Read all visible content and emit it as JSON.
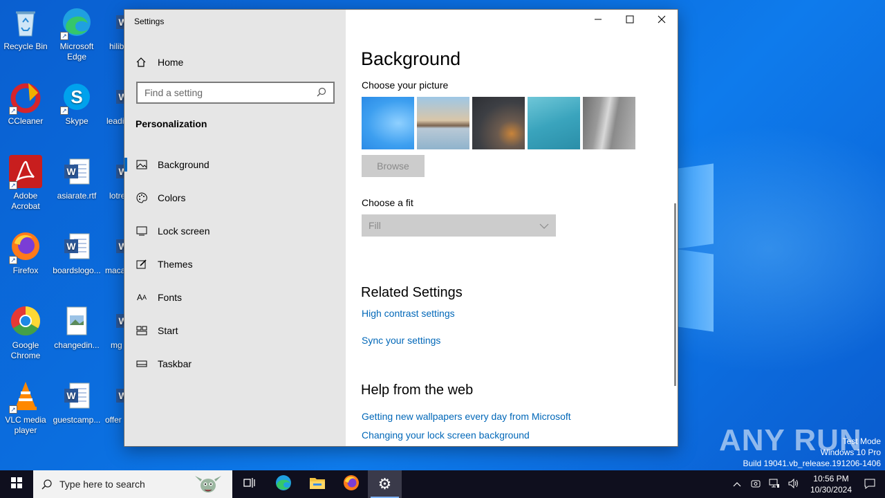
{
  "desktop": {
    "icons": [
      {
        "label": "Recycle Bin",
        "icon": "recycle-bin-icon"
      },
      {
        "label": "Microsoft Edge",
        "icon": "edge-icon"
      },
      {
        "label": "hilib",
        "icon": "word-doc-icon"
      },
      {
        "label": "CCleaner",
        "icon": "ccleaner-icon"
      },
      {
        "label": "Skype",
        "icon": "skype-icon"
      },
      {
        "label": "leadi",
        "icon": "word-doc-icon"
      },
      {
        "label": "Adobe Acrobat",
        "icon": "acrobat-icon"
      },
      {
        "label": "asiarate.rtf",
        "icon": "word-doc-icon"
      },
      {
        "label": "lotre",
        "icon": "word-doc-icon"
      },
      {
        "label": "Firefox",
        "icon": "firefox-icon"
      },
      {
        "label": "boardslogo...",
        "icon": "word-doc-icon"
      },
      {
        "label": "maca",
        "icon": "word-doc-icon"
      },
      {
        "label": "Google Chrome",
        "icon": "chrome-icon"
      },
      {
        "label": "changedin...",
        "icon": "image-file-icon"
      },
      {
        "label": "mg",
        "icon": "word-doc-icon"
      },
      {
        "label": "VLC media player",
        "icon": "vlc-icon"
      },
      {
        "label": "guestcamp...",
        "icon": "word-doc-icon"
      },
      {
        "label": "offer",
        "icon": "word-doc-icon"
      }
    ],
    "watermark": {
      "line1": "Test Mode",
      "line2": "Windows 10 Pro",
      "line3": "Build 19041.vb_release.191206-1406"
    },
    "brand": "ANY RUN"
  },
  "window": {
    "title": "Settings",
    "sidebar": {
      "home": "Home",
      "search_placeholder": "Find a setting",
      "section": "Personalization",
      "items": [
        {
          "label": "Background",
          "icon": "picture-icon",
          "active": true
        },
        {
          "label": "Colors",
          "icon": "palette-icon",
          "active": false
        },
        {
          "label": "Lock screen",
          "icon": "lock-screen-icon",
          "active": false
        },
        {
          "label": "Themes",
          "icon": "brush-icon",
          "active": false
        },
        {
          "label": "Fonts",
          "icon": "fonts-icon",
          "active": false
        },
        {
          "label": "Start",
          "icon": "start-tiles-icon",
          "active": false
        },
        {
          "label": "Taskbar",
          "icon": "taskbar-icon",
          "active": false
        }
      ]
    },
    "content": {
      "heading": "Background",
      "choose_picture": "Choose your picture",
      "browse": "Browse",
      "choose_fit": "Choose a fit",
      "fit_value": "Fill",
      "related_heading": "Related Settings",
      "related_links": [
        "High contrast settings",
        "Sync your settings"
      ],
      "help_heading": "Help from the web",
      "help_links": [
        "Getting new wallpapers every day from Microsoft",
        "Changing your lock screen background"
      ]
    }
  },
  "taskbar": {
    "search_placeholder": "Type here to search",
    "time": "10:56 PM",
    "date": "10/30/2024",
    "apps": [
      "task-view-icon",
      "edge-icon",
      "file-explorer-icon",
      "firefox-icon",
      "settings-gear-icon"
    ]
  },
  "colors": {
    "accent": "#0067c0",
    "link": "#0067b8",
    "sidebar_bg": "#e6e6e6",
    "taskbar_bg": "#0f0f1e"
  }
}
